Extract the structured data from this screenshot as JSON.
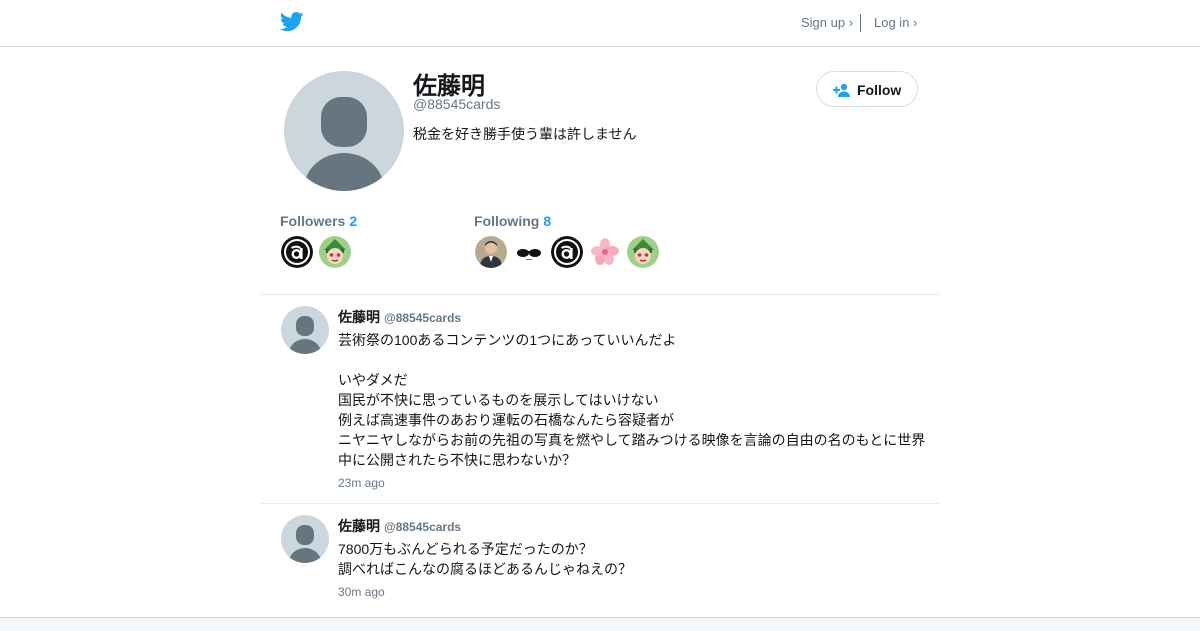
{
  "nav": {
    "signup_label": "Sign up ›",
    "login_label": "Log in ›",
    "brand_icon": "twitter-bird-icon",
    "brand_color": "#1da1f2"
  },
  "profile": {
    "name": "佐藤明",
    "handle": "@88545cards",
    "bio": "税金を好き勝手使う輩は許しません",
    "follow_label": "Follow",
    "followers_label": "Followers",
    "followers_count": "2",
    "following_label": "Following",
    "following_count": "8"
  },
  "tweets": [
    {
      "name": "佐藤明",
      "handle": "@88545cards",
      "text": "芸術祭の100あるコンテンツの1つにあっていいんだよ\n\nいやダメだ\n国民が不快に思っているものを展示してはいけない\n例えば高速事件のあおり運転の石橋なんたら容疑者が\nニヤニヤしながらお前の先祖の写真を燃やして踏みつける映像を言論の自由の名のもとに世界中に公開されたら不快に思わないか？",
      "time": "23m ago"
    },
    {
      "name": "佐藤明",
      "handle": "@88545cards",
      "text": "7800万もぶんどられる予定だったのか？\n調べればこんなの腐るほどあるんじゃねえの？",
      "time": "30m ago"
    }
  ],
  "colors": {
    "accent": "#1da1f2",
    "muted": "#657786",
    "text": "#14171a"
  }
}
